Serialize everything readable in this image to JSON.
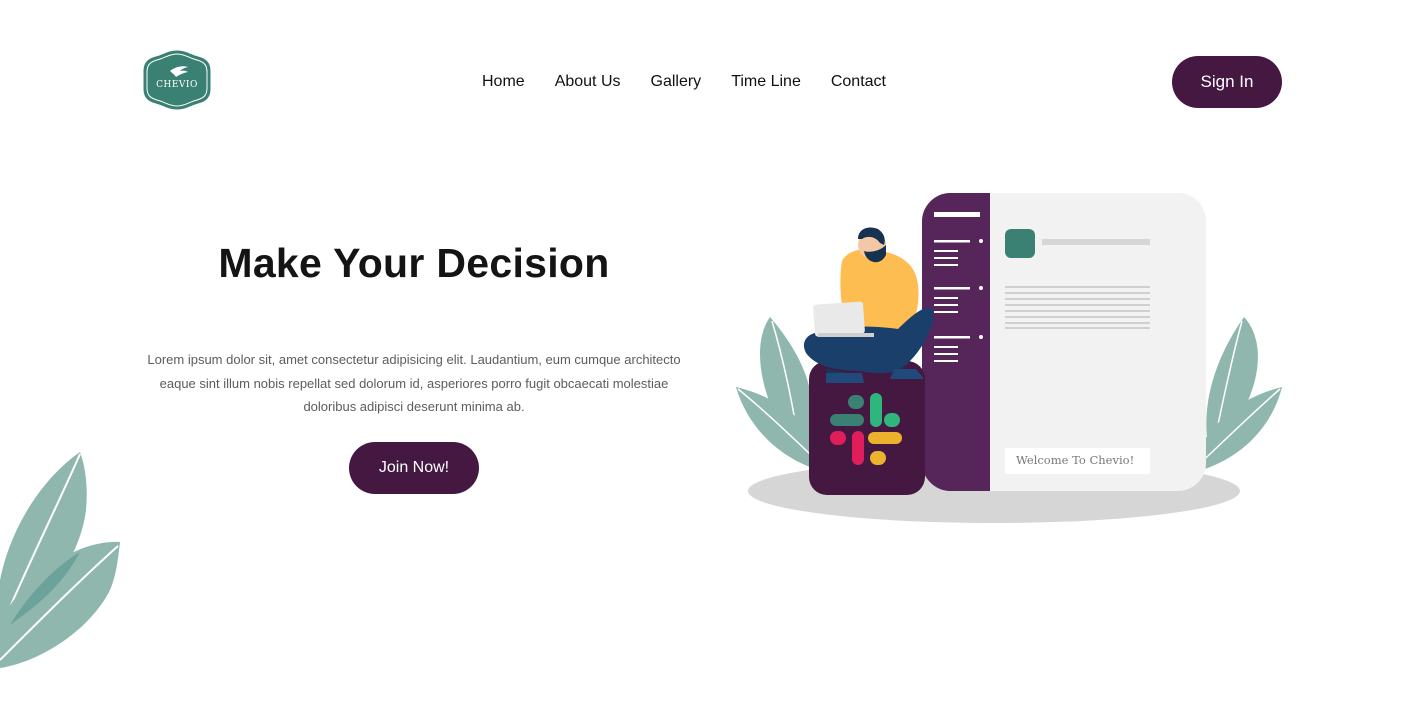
{
  "brand": {
    "logo_text": "CHEVIO",
    "accent_color": "#3a8073",
    "button_color": "#451842"
  },
  "nav": {
    "items": [
      {
        "label": "Home"
      },
      {
        "label": "About Us"
      },
      {
        "label": "Gallery"
      },
      {
        "label": "Time Line"
      },
      {
        "label": "Contact"
      }
    ],
    "signin_label": "Sign In"
  },
  "hero": {
    "title": "Make Your Decision",
    "text": "Lorem ipsum dolor sit, amet consectetur adipisicing elit. Laudantium, eum cumque architecto eaque sint illum nobis repellat sed dolorum id, asperiores porro fugit obcaecati molestiae doloribus adipisci deserunt minima ab.",
    "cta_label": "Join Now!"
  },
  "illustration": {
    "welcome_text": "Welcome To Chevio!",
    "icons": [
      "person-with-laptop",
      "slack-logo",
      "chat-window",
      "leaf-plant"
    ]
  }
}
